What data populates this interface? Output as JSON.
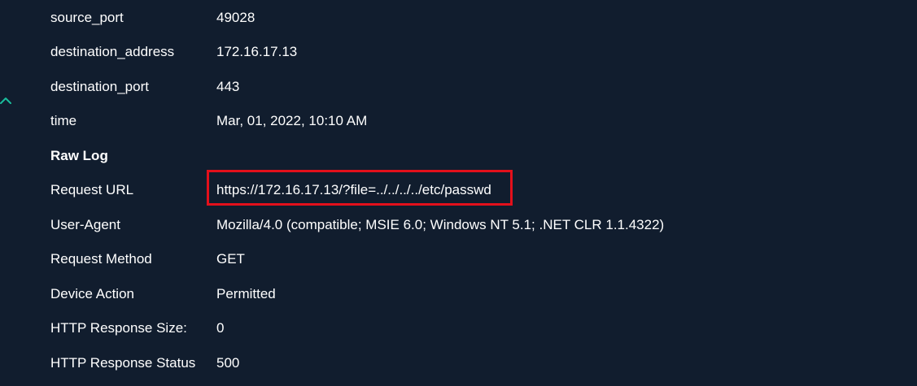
{
  "fields": [
    {
      "key": "source_port",
      "value": "49028"
    },
    {
      "key": "destination_address",
      "value": "172.16.17.13"
    },
    {
      "key": "destination_port",
      "value": "443"
    },
    {
      "key": "time",
      "value": "Mar, 01, 2022, 10:10 AM"
    }
  ],
  "raw_log": {
    "heading": "Raw Log",
    "fields": [
      {
        "key": "Request URL",
        "value": "https://172.16.17.13/?file=../../../../etc/passwd"
      },
      {
        "key": "User-Agent",
        "value": "Mozilla/4.0 (compatible; MSIE 6.0; Windows NT 5.1; .NET CLR 1.1.4322)"
      },
      {
        "key": "Request Method",
        "value": "GET"
      },
      {
        "key": "Device Action",
        "value": "Permitted"
      },
      {
        "key": "HTTP Response Size:",
        "value": "0"
      },
      {
        "key": "HTTP Response Status",
        "value": "500"
      }
    ]
  },
  "colors": {
    "background": "#111d2e",
    "text": "#ffffff",
    "highlight": "#e3101b",
    "accent": "#1abc9c"
  },
  "icons": {
    "collapse": "chevron-up-icon"
  }
}
